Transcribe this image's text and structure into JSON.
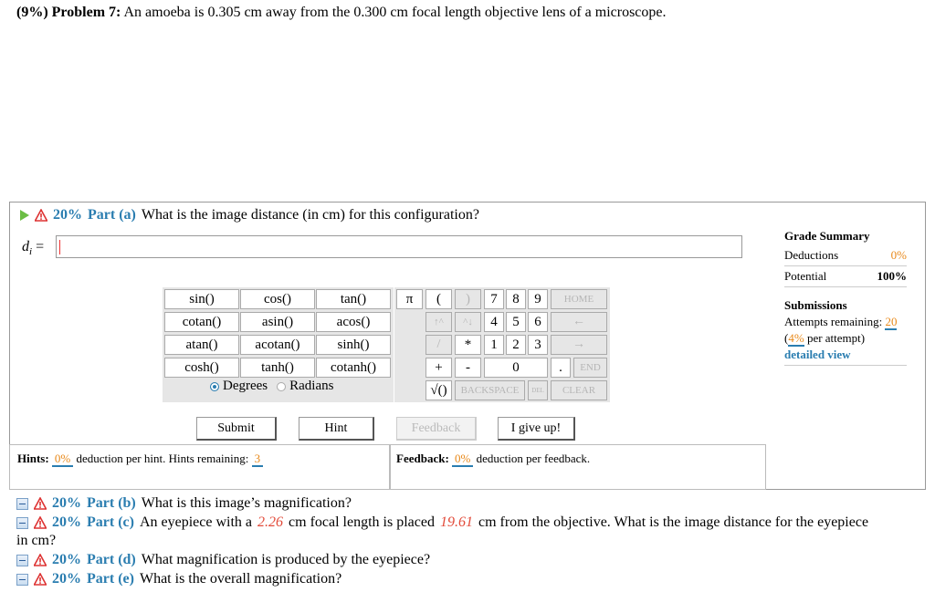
{
  "problem": {
    "weight": "(9%)",
    "title": "Problem 7:",
    "text": "An amoeba is 0.305 cm away from the 0.300 cm focal length objective lens of a microscope."
  },
  "part_a": {
    "weight": "20%",
    "label": "Part (a)",
    "question": "What is the image distance (in cm) for this configuration?",
    "var_label": "d",
    "var_sub": "i",
    "equals": "=",
    "answer_value": ""
  },
  "function_keys": [
    "sin()",
    "cos()",
    "tan()",
    "cotan()",
    "asin()",
    "acos()",
    "atan()",
    "acotan()",
    "sinh()",
    "cosh()",
    "tanh()",
    "cotanh()"
  ],
  "angle_mode": {
    "degrees": "Degrees",
    "radians": "Radians",
    "selected": "degrees"
  },
  "num_keys": {
    "pi": "π",
    "lparen": "(",
    "rparen": ")",
    "k7": "7",
    "k8": "8",
    "k9": "9",
    "home": "HOME",
    "up": "↑^",
    "down": "^↓",
    "k4": "4",
    "k5": "5",
    "k6": "6",
    "left": "←",
    "div": "/",
    "mul": "*",
    "k1": "1",
    "k2": "2",
    "k3": "3",
    "right": "→",
    "plus": "+",
    "minus": "-",
    "k0": "0",
    "dot": ".",
    "end": "END",
    "sqrt": "√()",
    "backspace": "BACKSPACE",
    "del": "DEL",
    "clear": "CLEAR"
  },
  "buttons": {
    "submit": "Submit",
    "hint": "Hint",
    "feedback": "Feedback",
    "give_up": "I give up!"
  },
  "hints": {
    "label": "Hints:",
    "pct": "0%",
    "text": "deduction per hint. Hints remaining:",
    "remaining": "3"
  },
  "feedback": {
    "label": "Feedback:",
    "pct": "0%",
    "text": "deduction per feedback."
  },
  "grade_summary": {
    "title": "Grade Summary",
    "deductions_label": "Deductions",
    "deductions_value": "0%",
    "potential_label": "Potential",
    "potential_value": "100%"
  },
  "submissions": {
    "title": "Submissions",
    "attempts_label": "Attempts remaining:",
    "attempts_value": "20",
    "per_attempt_pct": "4%",
    "per_attempt_text": "per attempt)",
    "open_paren": "(",
    "detailed_view": "detailed view"
  },
  "parts": {
    "b": {
      "weight": "20%",
      "label": "Part (b)",
      "question": "What is this image’s magnification?"
    },
    "c": {
      "weight": "20%",
      "label": "Part (c)",
      "q1": "An eyepiece with a",
      "v1": "2.26",
      "q2": "cm focal length is placed",
      "v2": "19.61",
      "q3": "cm from the objective. What is the image distance for the eyepiece",
      "q4": "in cm?"
    },
    "d": {
      "weight": "20%",
      "label": "Part (d)",
      "question": "What magnification is produced by the eyepiece?"
    },
    "e": {
      "weight": "20%",
      "label": "Part (e)",
      "question": "What is the overall magnification?"
    }
  },
  "colors": {
    "accent_blue": "#2a7db0",
    "orange": "#e8891a",
    "red": "#e24b3a",
    "green": "#6bbd45"
  }
}
